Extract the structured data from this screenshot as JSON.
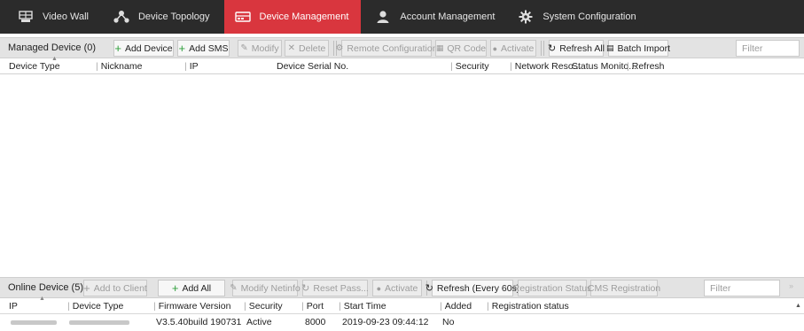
{
  "nav": {
    "items": [
      {
        "label": "Video Wall",
        "icon": "video-wall-icon",
        "active": false
      },
      {
        "label": "Device Topology",
        "icon": "topology-icon",
        "active": false
      },
      {
        "label": "Device Management",
        "icon": "device-management-icon",
        "active": true
      },
      {
        "label": "Account Management",
        "icon": "account-icon",
        "active": false
      },
      {
        "label": "System Configuration",
        "icon": "gear-icon",
        "active": false
      }
    ]
  },
  "managed": {
    "title": "Managed Device (0)",
    "buttons": {
      "add_device": "Add Device",
      "add_sms": "Add SMS",
      "modify": "Modify",
      "delete": "Delete",
      "remote_config": "Remote Configuration",
      "qr_code": "QR Code",
      "activate": "Activate",
      "refresh_all": "Refresh All",
      "batch_import": "Batch Import"
    },
    "filter_placeholder": "Filter",
    "columns": [
      "Device Type",
      "Nickname",
      "IP",
      "Device Serial No.",
      "Security",
      "Network Reso...",
      "Status Monito...",
      "Refresh"
    ]
  },
  "online": {
    "title": "Online Device (5)",
    "buttons": {
      "add_to_client": "Add to Client",
      "add_all": "Add All",
      "modify_netinfo": "Modify Netinfo",
      "reset_pass": "Reset Pass...",
      "activate": "Activate",
      "refresh_every": "Refresh (Every 60s)",
      "registration_status": "Registration Status",
      "cms_registration": "CMS Registration"
    },
    "filter_placeholder": "Filter",
    "columns": [
      "IP",
      "Device Type",
      "Firmware Version",
      "Security",
      "Port",
      "Start Time",
      "Added",
      "Registration status"
    ],
    "rows": [
      {
        "firmware": "V3.5.40build 190731",
        "security": "Active",
        "port": "8000",
        "start_time": "2019-09-23 09:44:12",
        "added": "No",
        "registration_status": ""
      }
    ]
  },
  "colors": {
    "nav_bg": "#2b2b2b",
    "nav_active": "#d9363e",
    "add_green": "#2e9e3a",
    "toolbar_bg": "#e3e3e3"
  }
}
